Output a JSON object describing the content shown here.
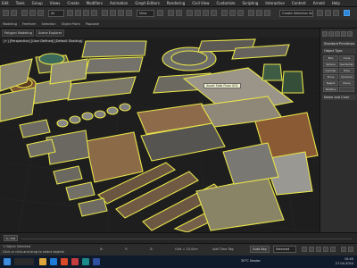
{
  "menubar": {
    "items": [
      "Edit",
      "Tools",
      "Group",
      "Views",
      "Create",
      "Modifiers",
      "Animation",
      "Graph Editors",
      "Rendering",
      "Civil View",
      "Customize",
      "Scripting",
      "Interactive",
      "Content",
      "Arnold",
      "Help"
    ]
  },
  "toolbar": {
    "selection_dropdown": "All",
    "view_dropdown": "View",
    "selection_set": "Create Selection Se"
  },
  "ribbon": {
    "items": [
      "Modeling",
      "Freeform",
      "Selection",
      "Object Paint",
      "Populate"
    ]
  },
  "viewport_tabs": [
    "Polygon Modeling",
    "Scene Explorer"
  ],
  "viewport": {
    "label": "[+] [Perspective] [User Defined] [Default Shading]",
    "tooltip": "Asset Slab Floor 001"
  },
  "command_panel": {
    "header": "Standard Primitives",
    "object_type_label": "Object Type",
    "buttons": [
      "Box",
      "Cone",
      "Sphere",
      "GeoSphere",
      "Cylinder",
      "Tube",
      "Torus",
      "Pyramid",
      "Teapot",
      "Plane",
      "TextPlus",
      ""
    ],
    "name_color_label": "Name and Color"
  },
  "timeline": {
    "frame": "0 / 100"
  },
  "status": {
    "selection": "1 Object Selected",
    "prompt": "Click or click-and-drag to select objects",
    "x_label": "X:",
    "y_label": "Y:",
    "z_label": "Z:",
    "grid": "Grid = 10.0cm",
    "add_time_tag": "Add Time Tag",
    "auto_key": "Auto Key",
    "selected": "Selected"
  },
  "taskbar": {
    "weather": "30°C Smoke",
    "time": "10:45",
    "date": "27-04-2024"
  },
  "colors": {
    "selection_outline": "#e8e44a",
    "accent_blue": "#2e86d8",
    "viewport_bg": "#1e1e1e"
  }
}
